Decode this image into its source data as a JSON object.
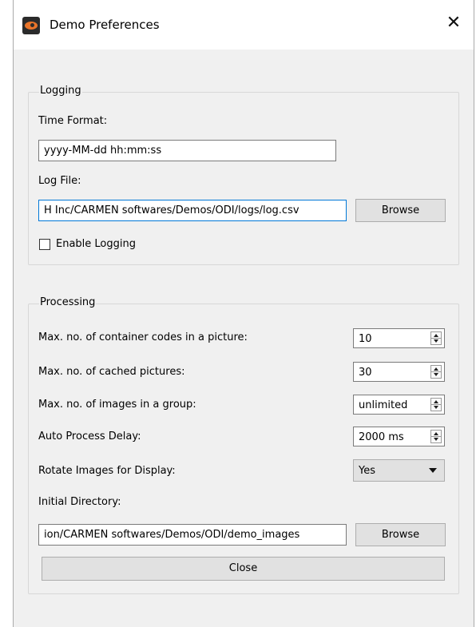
{
  "window": {
    "title": "Demo Preferences",
    "close_glyph": "✕",
    "app_icon": "eye-icon"
  },
  "logging": {
    "group_title": "Logging",
    "time_format_label": "Time Format:",
    "time_format_value": "yyyy-MM-dd hh:mm:ss",
    "log_file_label": "Log File:",
    "log_file_value": "H Inc/CARMEN softwares/Demos/ODI/logs/log.csv",
    "browse_label": "Browse",
    "enable_logging_label": "Enable Logging",
    "enable_logging_checked": false
  },
  "processing": {
    "group_title": "Processing",
    "rows": [
      {
        "label": "Max. no. of container codes in a picture:",
        "value": "10"
      },
      {
        "label": "Max. no. of cached pictures:",
        "value": "30"
      },
      {
        "label": "Max. no. of images in a group:",
        "value": "unlimited"
      },
      {
        "label": "Auto Process Delay:",
        "value": "2000 ms"
      }
    ],
    "rotate_label": "Rotate Images for Display:",
    "rotate_value": "Yes",
    "initial_dir_label": "Initial Directory:",
    "initial_dir_value": "ion/CARMEN softwares/Demos/ODI/demo_images",
    "browse_label": "Browse",
    "close_label": "Close"
  },
  "colors": {
    "focus_border": "#0078d7",
    "dialog_background": "#f0f0f0",
    "button_background": "#e1e1e1"
  }
}
